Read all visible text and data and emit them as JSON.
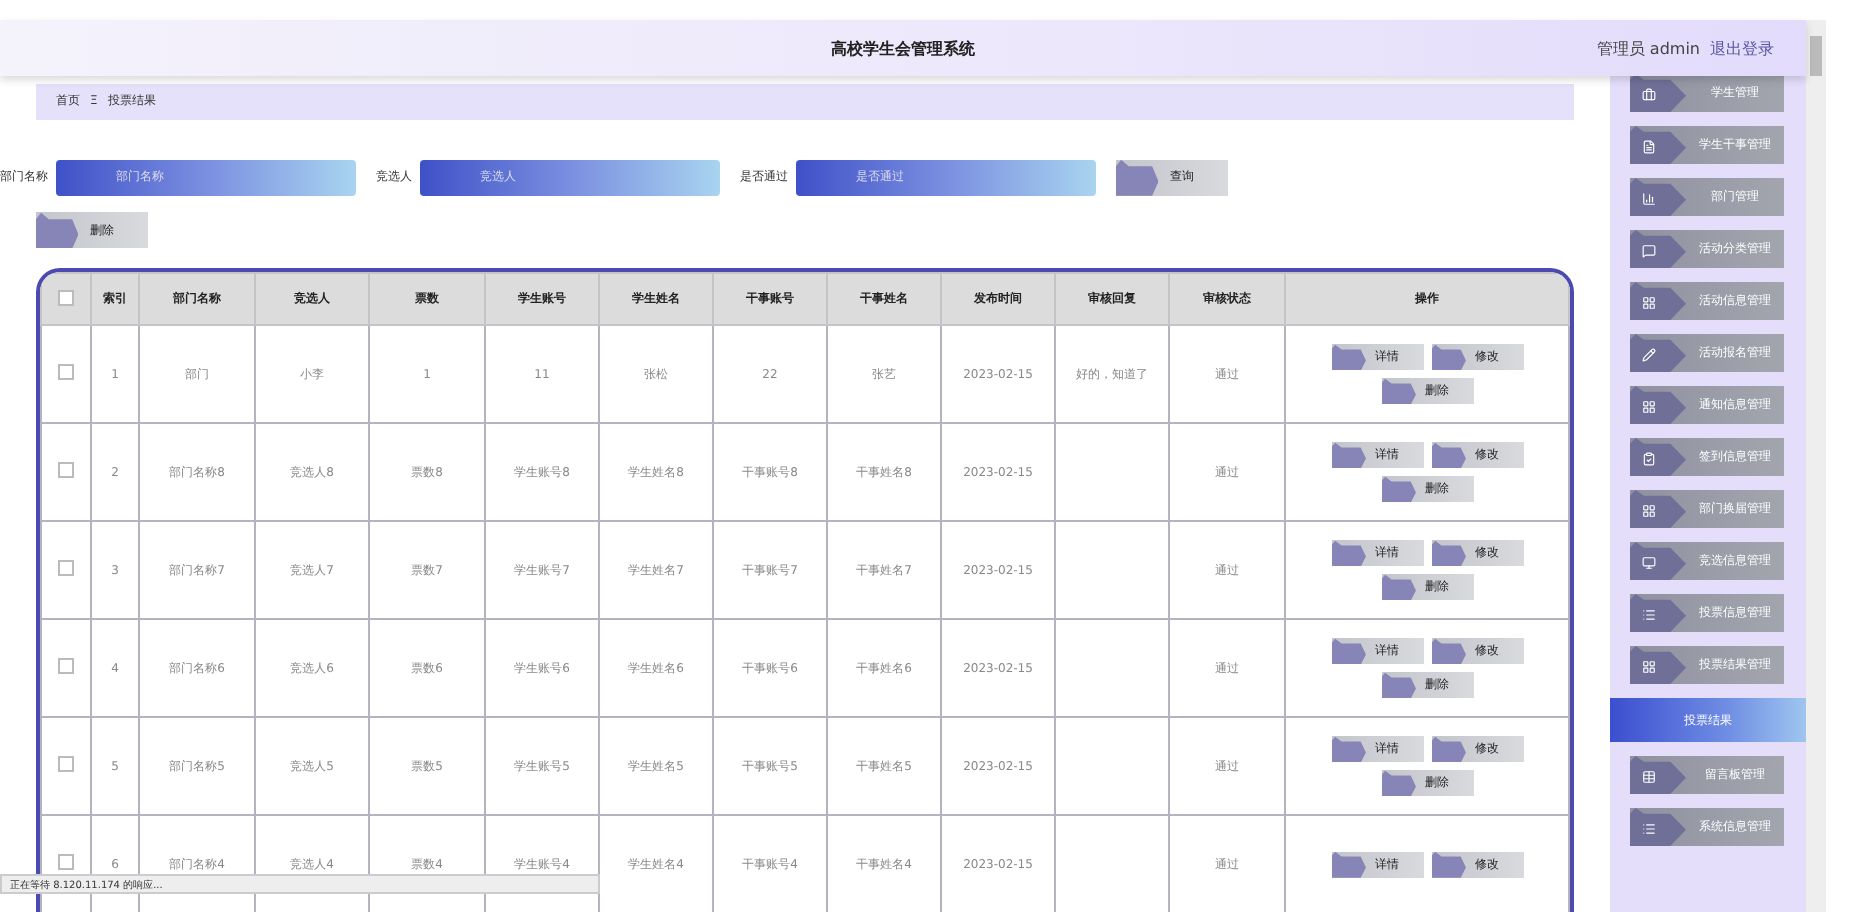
{
  "header": {
    "title": "高校学生会管理系统",
    "user": "管理员 admin",
    "logout": "退出登录"
  },
  "breadcrumb": {
    "home": "首页",
    "separator": "Ξ",
    "current": "投票结果"
  },
  "search": {
    "fields": [
      {
        "label": "部门名称",
        "placeholder": "部门名称"
      },
      {
        "label": "竞选人",
        "placeholder": "竞选人"
      },
      {
        "label": "是否通过",
        "placeholder": "是否通过"
      }
    ],
    "query_button": "查询",
    "delete_button": "删除"
  },
  "table": {
    "header_checked": false,
    "columns": [
      "索引",
      "部门名称",
      "竞选人",
      "票数",
      "学生账号",
      "学生姓名",
      "干事账号",
      "干事姓名",
      "发布时间",
      "审核回复",
      "审核状态",
      "操作"
    ],
    "rows": [
      {
        "checked": false,
        "cells": [
          "1",
          "部门",
          "小李",
          "1",
          "11",
          "张松",
          "22",
          "张艺",
          "2023-02-15",
          "好的，知道了",
          "通过"
        ],
        "actions": [
          "详情",
          "修改",
          "删除"
        ]
      },
      {
        "checked": false,
        "cells": [
          "2",
          "部门名称8",
          "竞选人8",
          "票数8",
          "学生账号8",
          "学生姓名8",
          "干事账号8",
          "干事姓名8",
          "2023-02-15",
          "",
          "通过"
        ],
        "actions": [
          "详情",
          "修改",
          "删除"
        ]
      },
      {
        "checked": false,
        "cells": [
          "3",
          "部门名称7",
          "竞选人7",
          "票数7",
          "学生账号7",
          "学生姓名7",
          "干事账号7",
          "干事姓名7",
          "2023-02-15",
          "",
          "通过"
        ],
        "actions": [
          "详情",
          "修改",
          "删除"
        ]
      },
      {
        "checked": false,
        "cells": [
          "4",
          "部门名称6",
          "竞选人6",
          "票数6",
          "学生账号6",
          "学生姓名6",
          "干事账号6",
          "干事姓名6",
          "2023-02-15",
          "",
          "通过"
        ],
        "actions": [
          "详情",
          "修改",
          "删除"
        ]
      },
      {
        "checked": false,
        "cells": [
          "5",
          "部门名称5",
          "竞选人5",
          "票数5",
          "学生账号5",
          "学生姓名5",
          "干事账号5",
          "干事姓名5",
          "2023-02-15",
          "",
          "通过"
        ],
        "actions": [
          "详情",
          "修改",
          "删除"
        ]
      },
      {
        "checked": false,
        "cells": [
          "6",
          "部门名称4",
          "竞选人4",
          "票数4",
          "学生账号4",
          "学生姓名4",
          "干事账号4",
          "干事姓名4",
          "2023-02-15",
          "",
          "通过"
        ],
        "actions": [
          "详情",
          "修改"
        ]
      }
    ]
  },
  "sidebar": {
    "items": [
      {
        "label": "学生管理",
        "selected": false
      },
      {
        "label": "学生干事管理",
        "selected": false
      },
      {
        "label": "部门管理",
        "selected": false
      },
      {
        "label": "活动分类管理",
        "selected": false
      },
      {
        "label": "活动信息管理",
        "selected": false
      },
      {
        "label": "活动报名管理",
        "selected": false
      },
      {
        "label": "通知信息管理",
        "selected": false
      },
      {
        "label": "签到信息管理",
        "selected": false
      },
      {
        "label": "部门换届管理",
        "selected": false
      },
      {
        "label": "竞选信息管理",
        "selected": false
      },
      {
        "label": "投票信息管理",
        "selected": false
      },
      {
        "label": "投票结果管理",
        "selected": false
      },
      {
        "label": "投票结果",
        "selected": true
      },
      {
        "label": "留言板管理",
        "selected": false
      },
      {
        "label": "系统信息管理",
        "selected": false
      }
    ]
  },
  "status_bar": "正在等待 8.120.11.174 的响应..."
}
